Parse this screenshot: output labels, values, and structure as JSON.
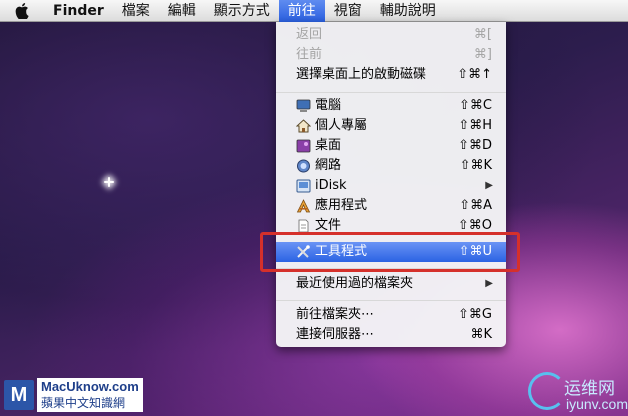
{
  "menubar": {
    "app": "Finder",
    "items": [
      "檔案",
      "編輯",
      "顯示方式",
      "前往",
      "視窗",
      "輔助說明"
    ],
    "active_index": 3
  },
  "go_menu": {
    "items": [
      {
        "label": "返回",
        "shortcut": "⌘[",
        "disabled": true
      },
      {
        "label": "往前",
        "shortcut": "⌘]",
        "disabled": true
      },
      {
        "label": "選擇桌面上的啟動磁碟",
        "shortcut": "⇧⌘↑"
      },
      {
        "label": "電腦",
        "shortcut": "⇧⌘C",
        "icon": "computer-icon"
      },
      {
        "label": "個人專屬",
        "shortcut": "⇧⌘H",
        "icon": "home-icon"
      },
      {
        "label": "桌面",
        "shortcut": "⇧⌘D",
        "icon": "desktop-icon"
      },
      {
        "label": "網路",
        "shortcut": "⇧⌘K",
        "icon": "network-icon"
      },
      {
        "label": "iDisk",
        "submenu_arrow": "▶",
        "icon": "idisk-icon"
      },
      {
        "label": "應用程式",
        "shortcut": "⇧⌘A",
        "icon": "applications-icon"
      },
      {
        "label": "文件",
        "shortcut": "⇧⌘O",
        "icon": "documents-icon"
      },
      {
        "label": "工具程式",
        "shortcut": "⇧⌘U",
        "icon": "utilities-icon",
        "highlighted": true
      },
      {
        "label": "最近使用過的檔案夾",
        "submenu_arrow": "▶"
      },
      {
        "label": "前往檔案夾⋯",
        "shortcut": "⇧⌘G"
      },
      {
        "label": "連接伺服器⋯",
        "shortcut": "⌘K"
      }
    ]
  },
  "watermarks": {
    "left_logo_letter": "M",
    "left_line1": "MacUknow.com",
    "left_line2": "蘋果中文知識網",
    "right_line1": "运维网",
    "right_line2": "iyunv.com"
  },
  "colors": {
    "highlight": "#2b63e3",
    "annotation_box": "#d5302b"
  }
}
